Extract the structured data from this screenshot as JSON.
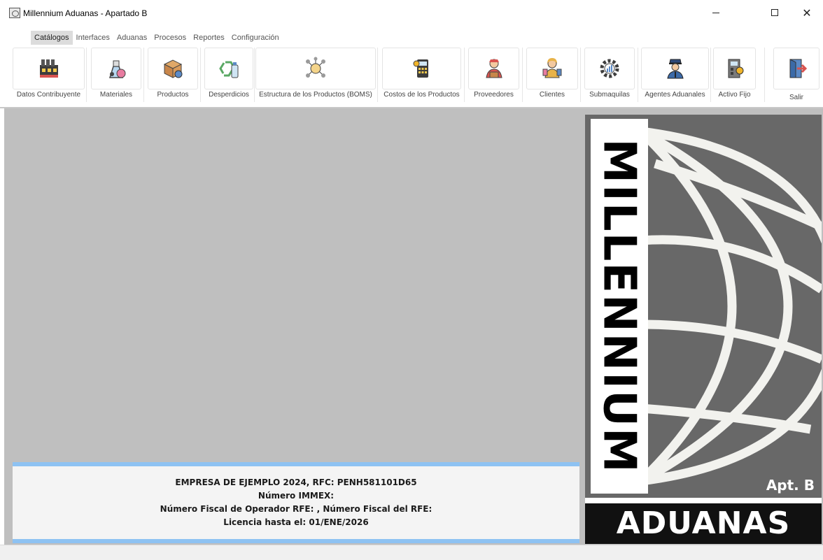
{
  "window": {
    "title": "Millennium Aduanas - Apartado B",
    "controls": {
      "minimize": "minimize",
      "maximize": "maximize",
      "close": "✕"
    }
  },
  "menu": [
    {
      "label": "Catálogos",
      "active": true
    },
    {
      "label": "Interfaces",
      "active": false
    },
    {
      "label": "Aduanas",
      "active": false
    },
    {
      "label": "Procesos",
      "active": false
    },
    {
      "label": "Reportes",
      "active": false
    },
    {
      "label": "Configuración",
      "active": false
    }
  ],
  "toolbar": [
    {
      "label": "Datos Contribuyente",
      "icon": "factory-icon"
    },
    {
      "label": "Materiales",
      "icon": "materials-icon"
    },
    {
      "label": "Productos",
      "icon": "box-icon"
    },
    {
      "label": "Desperdicios",
      "icon": "recycle-icon"
    },
    {
      "label": "Estructura de los Productos (BOMS)",
      "icon": "network-icon"
    },
    {
      "label": "Costos de los Productos",
      "icon": "calculator-icon"
    },
    {
      "label": "Proveedores",
      "icon": "delivery-man-icon"
    },
    {
      "label": "Clientes",
      "icon": "client-icon"
    },
    {
      "label": "Submaquilas",
      "icon": "gear-chart-icon"
    },
    {
      "label": "Agentes Aduanales",
      "icon": "officer-icon"
    },
    {
      "label": "Activo Fijo",
      "icon": "machine-icon"
    },
    {
      "label": "Salir",
      "icon": "exit-door-icon"
    }
  ],
  "info": {
    "line1": "EMPRESA DE EJEMPLO 2024, RFC: PENH581101D65",
    "line2": "Número IMMEX:",
    "line3": "Número Fiscal de Operador RFE:  , Número Fiscal del RFE:",
    "line4": "Licencia hasta el: 01/ENE/2026"
  },
  "logo": {
    "vertical_text": "MILLENNIUM",
    "badge": "Apt. B",
    "bottom_text": "ADUANAS"
  },
  "colors": {
    "workspace": "#bfbfbf",
    "info_border": "#8ec2f2",
    "logo_gray": "#686868"
  }
}
